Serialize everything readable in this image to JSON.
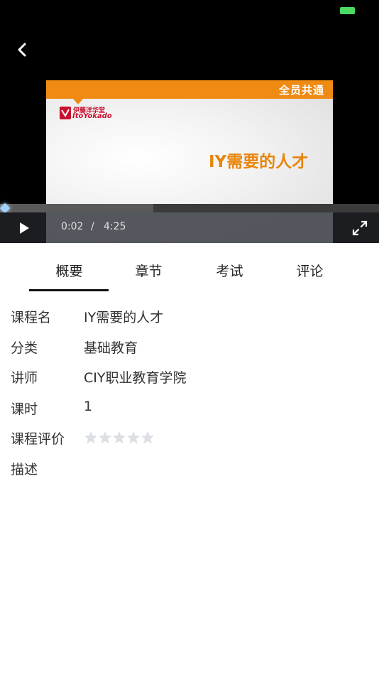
{
  "video": {
    "slide_tag": "全员共通",
    "logo_cn": "伊藤洋华堂",
    "logo_en": "ItoYokado",
    "slide_title": "IY需要的人才",
    "current_time": "0:02",
    "time_separator": "/",
    "duration": "4:25",
    "progress_fraction": 0.405
  },
  "tabs": [
    "概要",
    "章节",
    "考试",
    "评论"
  ],
  "active_tab": "概要",
  "details": {
    "course_name_label": "课程名",
    "course_name": "IY需要的人才",
    "category_label": "分类",
    "category": "基础教育",
    "lecturer_label": "讲师",
    "lecturer": "CIY职业教育学院",
    "hours_label": "课时",
    "hours": "1",
    "rating_label": "课程评价",
    "rating": 0,
    "rating_max": 5,
    "description_label": "描述"
  },
  "colors": {
    "slide_orange": "#ef8a12",
    "title_orange": "#e8850c",
    "battery_green": "#4cd964",
    "logo_red": "#c8102e",
    "star_empty": "#dcdfe4"
  }
}
